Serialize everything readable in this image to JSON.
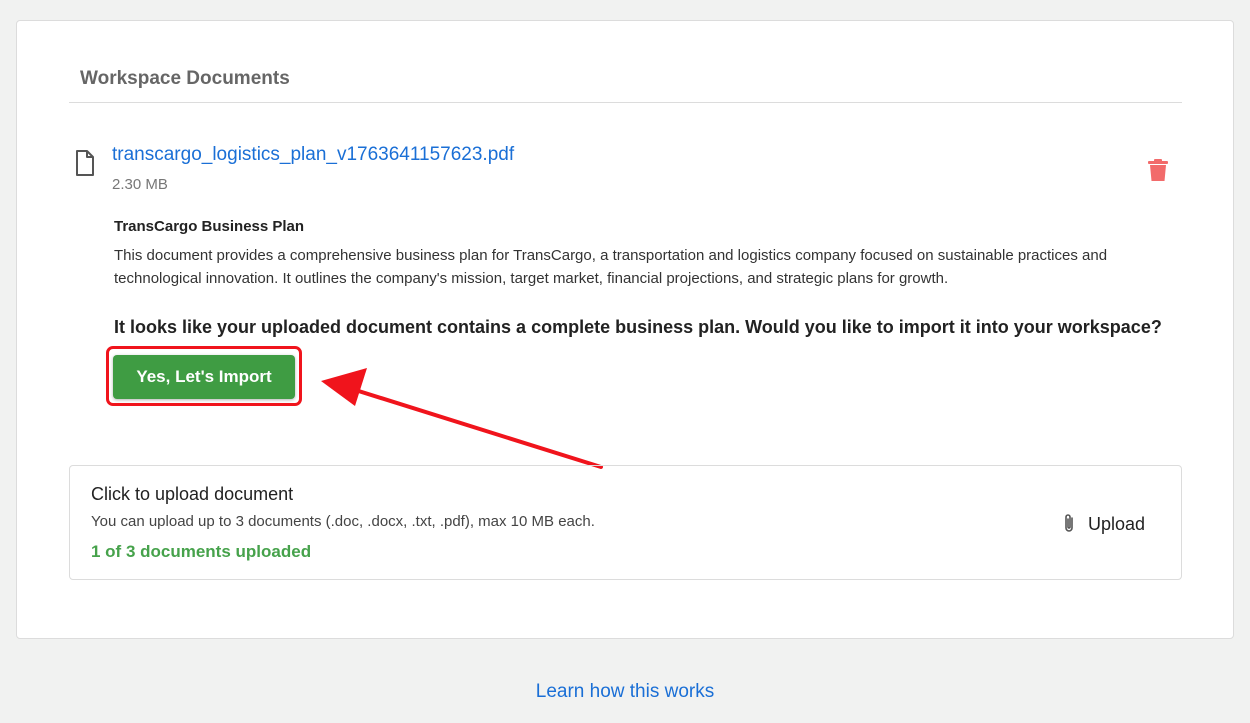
{
  "section": {
    "title": "Workspace Documents"
  },
  "document": {
    "file_name": "transcargo_logistics_plan_v1763641157623.pdf",
    "file_size": "2.30 MB",
    "summary_title": "TransCargo Business Plan",
    "summary_text": "This document provides a comprehensive business plan for TransCargo, a transportation and logistics company focused on sustainable practices and technological innovation. It outlines the company's mission, target market, financial projections, and strategic plans for growth.",
    "import_question": "It looks like your uploaded document contains a complete business plan. Would you like to import it into your workspace?",
    "import_button_label": "Yes, Let's Import"
  },
  "upload": {
    "title": "Click to upload document",
    "description": "You can upload up to 3 documents (.doc, .docx, .txt, .pdf), max 10 MB each.",
    "count_text": "1 of 3 documents uploaded",
    "button_label": "Upload"
  },
  "footer": {
    "learn_link": "Learn how this works"
  },
  "colors": {
    "link": "#1a6fd6",
    "import_button": "#3f9c43",
    "highlight": "#f0141c",
    "delete": "#f26b6b",
    "count_text": "#46a24b"
  },
  "icons": {
    "file": "file-icon",
    "delete": "trash-icon",
    "attach": "paperclip-icon"
  }
}
